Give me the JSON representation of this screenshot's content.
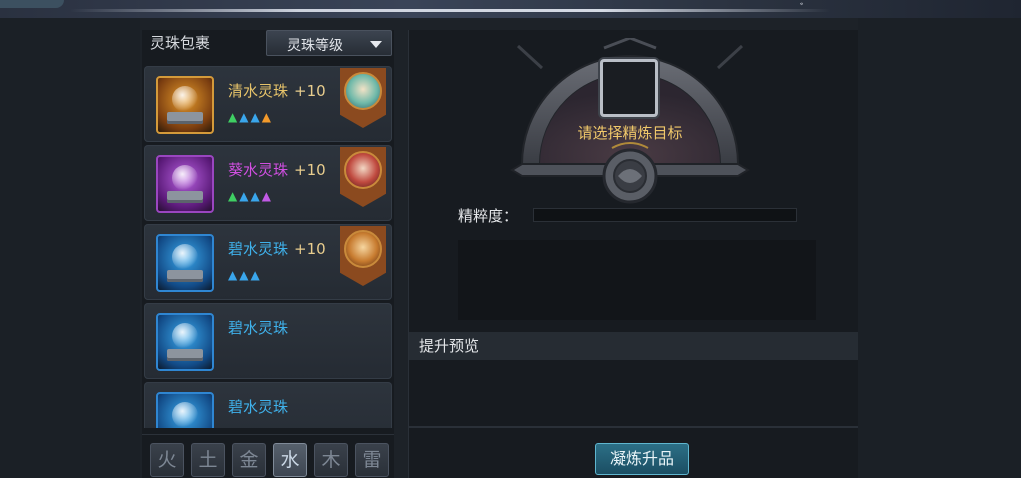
{
  "top": {
    "mark": "ﾞ"
  },
  "bag": {
    "title": "灵珠包裹",
    "sort_selected": "灵珠等级"
  },
  "items": [
    {
      "name": "清水灵珠",
      "level": "+10",
      "color": "#e6c36a",
      "frame": "gold",
      "flames": [
        "green",
        "blue",
        "blue",
        "orange"
      ],
      "equipped_by": "hero-1"
    },
    {
      "name": "葵水灵珠",
      "level": "+10",
      "color": "#d04fe0",
      "frame": "purple",
      "flames": [
        "green",
        "blue",
        "blue",
        "purple"
      ],
      "equipped_by": "hero-2"
    },
    {
      "name": "碧水灵珠",
      "level": "+10",
      "color": "#3fb1ea",
      "frame": "blue",
      "flames": [
        "blue",
        "blue",
        "blue"
      ],
      "equipped_by": "hero-3"
    },
    {
      "name": "碧水灵珠",
      "level": "",
      "color": "#3fb1ea",
      "frame": "blue",
      "flames": [],
      "equipped_by": ""
    },
    {
      "name": "碧水灵珠",
      "level": "",
      "color": "#3fb1ea",
      "frame": "blue",
      "flames": [],
      "equipped_by": ""
    }
  ],
  "element_tabs": [
    {
      "glyph": "火",
      "element": "fire"
    },
    {
      "glyph": "土",
      "element": "earth"
    },
    {
      "glyph": "金",
      "element": "metal"
    },
    {
      "glyph": "水",
      "element": "water",
      "active": true
    },
    {
      "glyph": "木",
      "element": "wood"
    },
    {
      "glyph": "雷",
      "element": "thunder"
    }
  ],
  "refine": {
    "prompt": "请选择精炼目标",
    "purity_label": "精粹度：",
    "purity_progress": 0,
    "preview_title": "提升预览",
    "button_label": "凝炼升品"
  }
}
